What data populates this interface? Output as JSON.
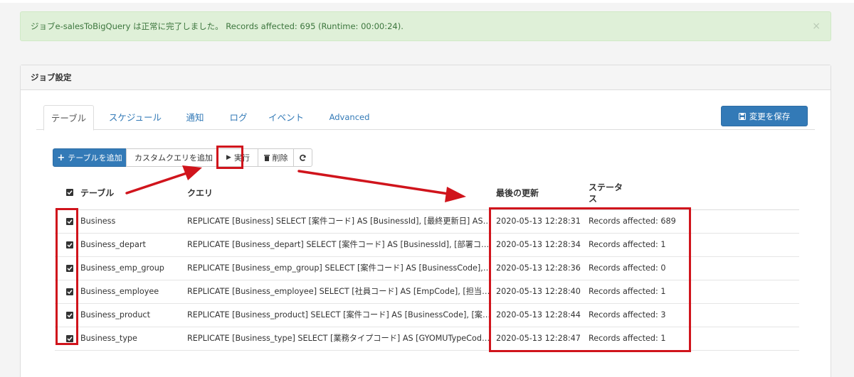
{
  "alert": {
    "message": "ジョブe-salesToBigQuery は正常に完了しました。 Records affected: 695 (Runtime: 00:00:24).",
    "close": "×"
  },
  "panel": {
    "title": "ジョブ設定"
  },
  "tabs": [
    {
      "label": "テーブル",
      "active": true
    },
    {
      "label": "スケジュール",
      "active": false
    },
    {
      "label": "通知",
      "active": false
    },
    {
      "label": "ログ",
      "active": false
    },
    {
      "label": "イベント",
      "active": false
    },
    {
      "label": "Advanced",
      "active": false
    }
  ],
  "save_button": {
    "label": "変更を保存",
    "icon": "floppy-disk-icon"
  },
  "toolbar": {
    "add_table": "テーブルを追加",
    "add_custom_query": "カスタムクエリを追加",
    "run": "実行",
    "delete": "削除"
  },
  "table": {
    "headers": {
      "table": "テーブル",
      "query": "クエリ",
      "last_updated": "最後の更新",
      "status": "ステータス"
    },
    "rows": [
      {
        "checked": true,
        "table": "Business",
        "query": "REPLICATE [Business] SELECT [案件コード] AS [BusinessId], [最終更新日] AS [lastda...",
        "last_updated": "2020-05-13 12:28:31",
        "status": "Records affected: 689"
      },
      {
        "checked": true,
        "table": "Business_depart",
        "query": "REPLICATE [Business_depart] SELECT [案件コード] AS [BusinessId], [部署コード] AS...",
        "last_updated": "2020-05-13 12:28:34",
        "status": "Records affected: 1"
      },
      {
        "checked": true,
        "table": "Business_emp_group",
        "query": "REPLICATE [Business_emp_group] SELECT [案件コード] AS [BusinessCode], [社員グ...",
        "last_updated": "2020-05-13 12:28:36",
        "status": "Records affected: 0"
      },
      {
        "checked": true,
        "table": "Business_employee",
        "query": "REPLICATE [Business_employee] SELECT [社員コード] AS [EmpCode], [担当者権限...",
        "last_updated": "2020-05-13 12:28:40",
        "status": "Records affected: 1"
      },
      {
        "checked": true,
        "table": "Business_product",
        "query": "REPLICATE [Business_product] SELECT [案件コード] AS [BusinessCode], [案件商品...",
        "last_updated": "2020-05-13 12:28:44",
        "status": "Records affected: 3"
      },
      {
        "checked": true,
        "table": "Business_type",
        "query": "REPLICATE [Business_type] SELECT [業務タイプコード] AS [GYOMUTypeCode], [業...",
        "last_updated": "2020-05-13 12:28:47",
        "status": "Records affected: 1"
      }
    ]
  },
  "colors": {
    "accent": "#337ab7",
    "success_bg": "#dff0d8",
    "annotation_red": "#d0141c"
  }
}
